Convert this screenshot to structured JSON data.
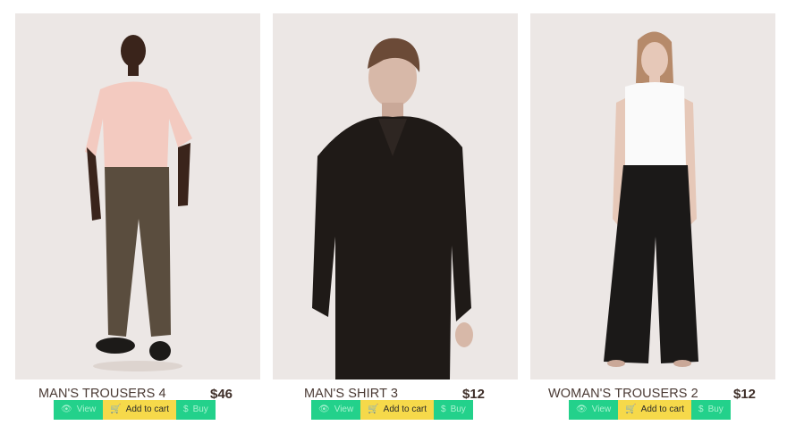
{
  "products": [
    {
      "name": "MAN'S TROUSERS 4",
      "price": "$46",
      "actions": {
        "view": "View",
        "add_to_cart": "Add to cart",
        "buy": "Buy"
      }
    },
    {
      "name": "MAN'S SHIRT 3",
      "price": "$12",
      "actions": {
        "view": "View",
        "add_to_cart": "Add to cart",
        "buy": "Buy"
      }
    },
    {
      "name": "WOMAN'S TROUSERS 2",
      "price": "$12",
      "actions": {
        "view": "View",
        "add_to_cart": "Add to cart",
        "buy": "Buy"
      }
    }
  ],
  "icons": {
    "view": "eye-icon",
    "cart": "cart-icon",
    "buy": "dollar-icon"
  },
  "colors": {
    "photo_bg": "#ece7e5",
    "green": "#23d18b",
    "yellow": "#f6d94a",
    "text": "#4a3a34"
  }
}
